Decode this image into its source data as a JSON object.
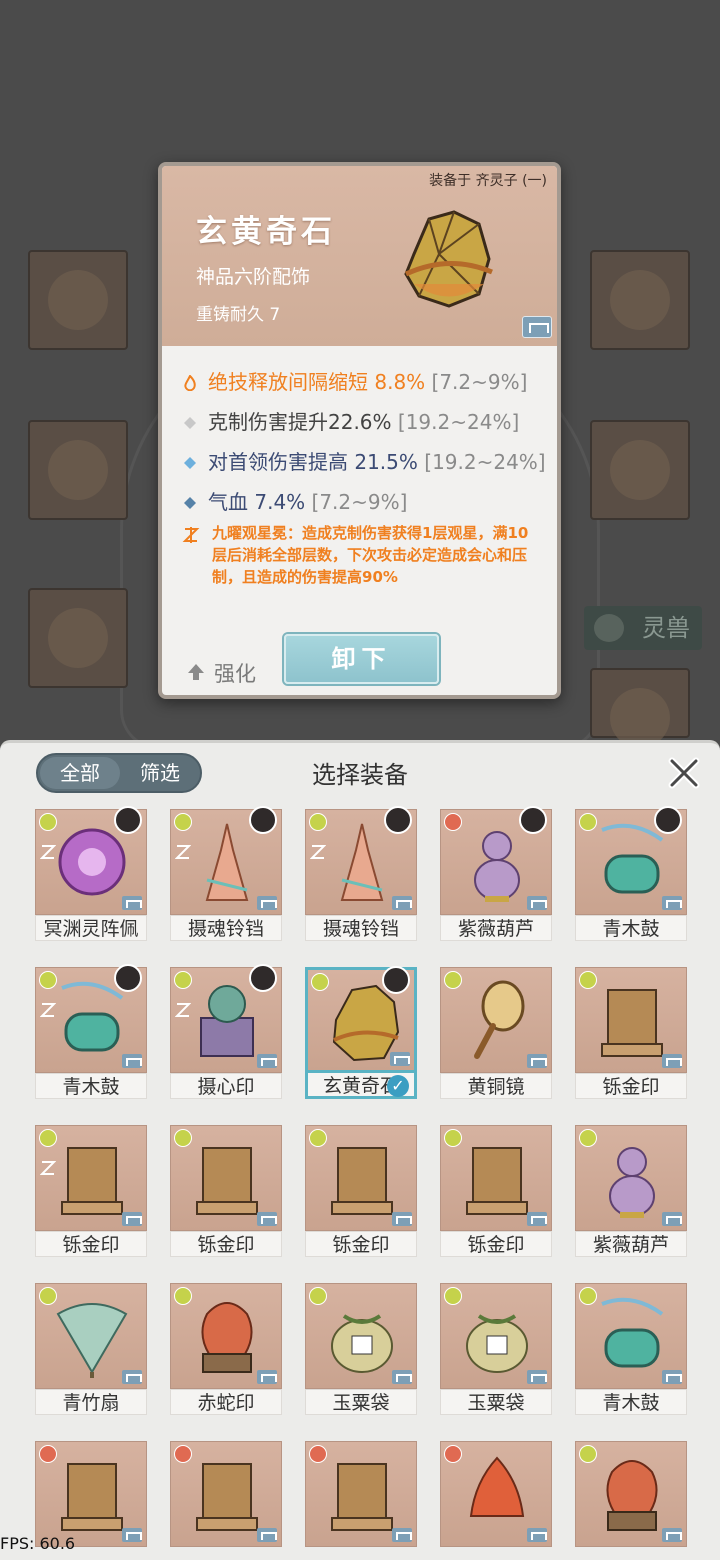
{
  "detail": {
    "equipped_by": "装备于 齐灵子 (一)",
    "name": "玄黄奇石",
    "grade": "神品六阶配饰",
    "recast": "重铸耐久 7",
    "stats": [
      {
        "text": "绝技释放间隔缩短 8.8%",
        "range": "[7.2~9%]",
        "style": "orange",
        "icon": "flame-icon"
      },
      {
        "text": "克制伤害提升22.6%",
        "range": "[19.2~24%]",
        "style": "grey",
        "icon": "diamond-grey-icon"
      },
      {
        "text": "对首领伤害提高 21.5%",
        "range": "[19.2~24%]",
        "style": "blue-light",
        "icon": "diamond-blue-icon"
      },
      {
        "text": "气血 7.4%",
        "range": "[7.2~9%]",
        "style": "blue",
        "icon": "diamond-dark-icon"
      }
    ],
    "skill": "九曜观星冕：造成克制伤害获得1层观星，满10层后消耗全部层数，下次攻击必定造成会心和压制，且造成的伤害提高90%",
    "enhance_label": "强化",
    "unequip_label": "卸下"
  },
  "background": {
    "beast_label": "灵兽"
  },
  "selector": {
    "tabs": [
      "全部",
      "筛选"
    ],
    "active_tab": "全部",
    "title": "选择装备",
    "items": [
      {
        "name": "冥渊灵阵佩",
        "tag": "green",
        "avatar": true,
        "sig": true,
        "art": "purple-disc"
      },
      {
        "name": "摄魂铃铛",
        "tag": "green",
        "avatar": true,
        "sig": true,
        "art": "bell"
      },
      {
        "name": "摄魂铃铛",
        "tag": "green",
        "avatar": true,
        "sig": true,
        "art": "bell"
      },
      {
        "name": "紫薇葫芦",
        "tag": "red",
        "avatar": true,
        "sig": false,
        "art": "gourd"
      },
      {
        "name": "青木鼓",
        "tag": "green",
        "avatar": true,
        "sig": false,
        "art": "drum"
      },
      {
        "name": "青木鼓",
        "tag": "green",
        "avatar": true,
        "sig": true,
        "art": "drum"
      },
      {
        "name": "摄心印",
        "tag": "green",
        "avatar": true,
        "sig": true,
        "art": "seal-purple"
      },
      {
        "name": "玄黄奇石",
        "tag": "green",
        "avatar": true,
        "sig": false,
        "art": "stone",
        "selected": true
      },
      {
        "name": "黄铜镜",
        "tag": "green",
        "avatar": false,
        "sig": false,
        "art": "mirror"
      },
      {
        "name": "铄金印",
        "tag": "green",
        "avatar": false,
        "sig": false,
        "art": "seal-gold"
      },
      {
        "name": "铄金印",
        "tag": "green",
        "avatar": false,
        "sig": true,
        "art": "seal-gold"
      },
      {
        "name": "铄金印",
        "tag": "green",
        "avatar": false,
        "sig": false,
        "art": "seal-gold"
      },
      {
        "name": "铄金印",
        "tag": "green",
        "avatar": false,
        "sig": false,
        "art": "seal-gold"
      },
      {
        "name": "铄金印",
        "tag": "green",
        "avatar": false,
        "sig": false,
        "art": "seal-gold"
      },
      {
        "name": "紫薇葫芦",
        "tag": "green",
        "avatar": false,
        "sig": false,
        "art": "gourd"
      },
      {
        "name": "青竹扇",
        "tag": "green",
        "avatar": false,
        "sig": false,
        "art": "fan"
      },
      {
        "name": "赤蛇印",
        "tag": "green",
        "avatar": false,
        "sig": false,
        "art": "seal-red"
      },
      {
        "name": "玉粟袋",
        "tag": "green",
        "avatar": false,
        "sig": false,
        "art": "bag"
      },
      {
        "name": "玉粟袋",
        "tag": "green",
        "avatar": false,
        "sig": false,
        "art": "bag"
      },
      {
        "name": "青木鼓",
        "tag": "green",
        "avatar": false,
        "sig": false,
        "art": "drum"
      },
      {
        "name": "",
        "tag": "red",
        "avatar": false,
        "sig": false,
        "art": "seal-gold"
      },
      {
        "name": "",
        "tag": "red",
        "avatar": false,
        "sig": false,
        "art": "seal-gold"
      },
      {
        "name": "",
        "tag": "red",
        "avatar": false,
        "sig": false,
        "art": "seal-gold"
      },
      {
        "name": "",
        "tag": "red",
        "avatar": false,
        "sig": false,
        "art": "flame-rock"
      },
      {
        "name": "",
        "tag": "green",
        "avatar": false,
        "sig": false,
        "art": "seal-red"
      }
    ]
  },
  "fps": "FPS: 60.6",
  "colors": {
    "accent_orange": "#f08020",
    "selected_border": "#5ab3c4",
    "card_header": "#d9b8a5"
  }
}
